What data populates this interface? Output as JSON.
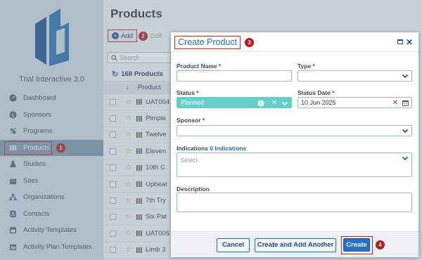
{
  "app": {
    "title": "Trial Interactive 3.0"
  },
  "sidebar": {
    "items": [
      {
        "label": "Dashboard",
        "icon": "dashboard-icon"
      },
      {
        "label": "Sponsors",
        "icon": "sponsors-icon"
      },
      {
        "label": "Programs",
        "icon": "programs-icon"
      },
      {
        "label": "Products",
        "icon": "products-icon",
        "active": true
      },
      {
        "label": "Studies",
        "icon": "studies-icon"
      },
      {
        "label": "Sites",
        "icon": "sites-icon"
      },
      {
        "label": "Organizations",
        "icon": "organizations-icon"
      },
      {
        "label": "Contacts",
        "icon": "contacts-icon"
      },
      {
        "label": "Activity Templates",
        "icon": "activity-templates-icon"
      },
      {
        "label": "Activity Plan Templates",
        "icon": "activity-plan-templates-icon"
      }
    ]
  },
  "page": {
    "title": "Products",
    "toolbar": {
      "add_label": "Add",
      "edit_label": "Edit"
    },
    "search_placeholder": "Search",
    "count_label": "168 Products",
    "grid": {
      "column": "Product",
      "rows": [
        "UAT004",
        "Pimple",
        "Twelve",
        "Eleven",
        "10th C",
        "Upbeat",
        "7th Try",
        "Six Pat",
        "UAT005",
        "Limb 3"
      ]
    }
  },
  "modal": {
    "title": "Create Product",
    "fields": {
      "product_name": {
        "label": "Product Name",
        "required": "*",
        "value": ""
      },
      "type": {
        "label": "Type",
        "required": "*",
        "value": ""
      },
      "status": {
        "label": "Status",
        "required": "*",
        "value": "Planned"
      },
      "status_date": {
        "label": "Status Date",
        "required": "*",
        "value": "10 Jun 2025"
      },
      "sponsor": {
        "label": "Sponsor",
        "required": "*",
        "value": ""
      },
      "indications": {
        "label": "Indications",
        "count": "0 Indications",
        "placeholder": "Select"
      },
      "description": {
        "label": "Description",
        "value": ""
      }
    },
    "buttons": {
      "cancel": "Cancel",
      "create_another": "Create and Add Another",
      "create": "Create"
    }
  },
  "callouts": {
    "products_nav": "1",
    "add_button": "2",
    "modal_title": "3",
    "create_button": "4"
  },
  "colors": {
    "accent": "#2470c4",
    "status_fill": "#66cfc6",
    "callout": "#b71c1c",
    "sidebar_bg": "#cfd7df"
  }
}
